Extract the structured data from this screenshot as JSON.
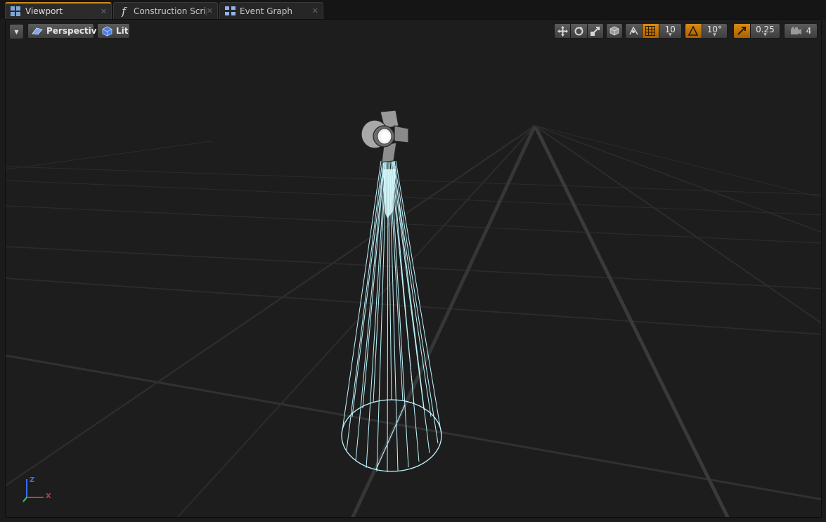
{
  "tabs": [
    {
      "label": "Viewport",
      "icon": "viewport-icon"
    },
    {
      "label": "Construction Scrip",
      "icon": "function-icon"
    },
    {
      "label": "Event Graph",
      "icon": "event-graph-icon"
    }
  ],
  "toolbar": {
    "view_mode": "Perspective",
    "lighting_mode": "Lit",
    "grid_snap_value": "10",
    "rotation_snap_value": "10°",
    "scale_snap_value": "0.25",
    "camera_speed": "4"
  },
  "axis_labels": {
    "x": "X",
    "z": "Z"
  },
  "colors": {
    "accent": "#d08a1a",
    "snap_active": "#d98b12",
    "light_cone": "#bff6ff",
    "grid": "#2f2f2f",
    "viewport_bg": "#1d1d1d",
    "axis_x": "#e03030",
    "axis_y": "#3ad13a",
    "axis_z": "#3a6ef0"
  }
}
